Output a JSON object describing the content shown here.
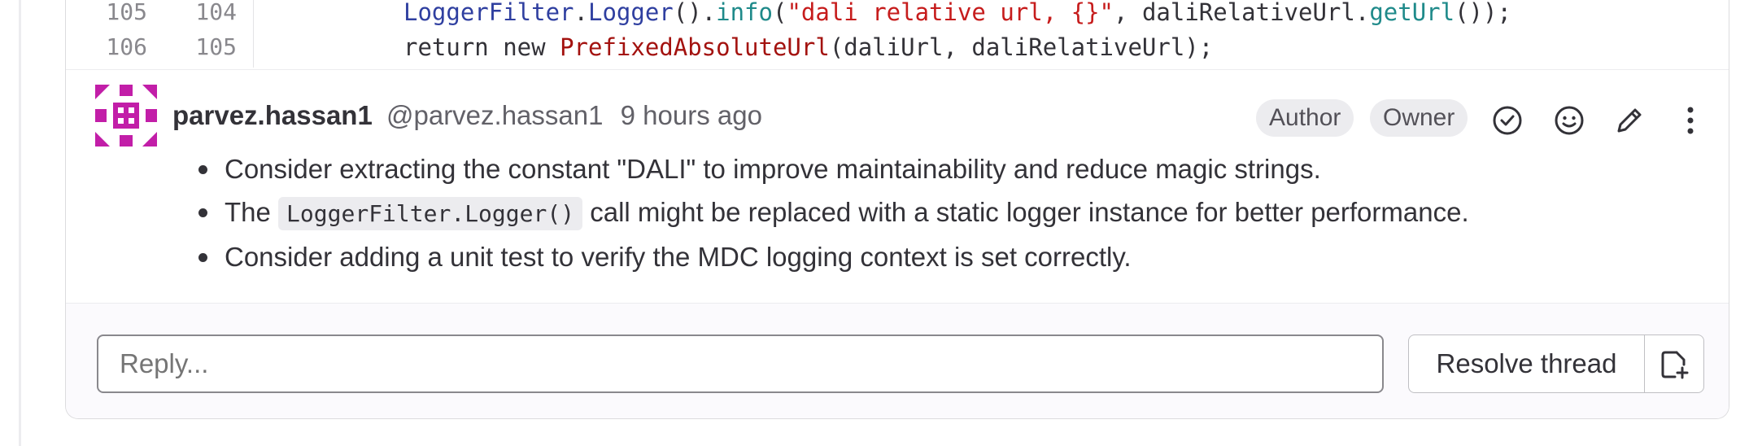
{
  "diff": {
    "lines": [
      {
        "old": "105",
        "new": "104",
        "tokens": [
          {
            "t": "LoggerFilter",
            "c": "cls"
          },
          {
            "t": ".",
            "c": "kw"
          },
          {
            "t": "Logger",
            "c": "cls"
          },
          {
            "t": "().",
            "c": "kw"
          },
          {
            "t": "info",
            "c": "fn"
          },
          {
            "t": "(",
            "c": "kw"
          },
          {
            "t": "\"dali relative url, {}\"",
            "c": "str"
          },
          {
            "t": ", daliRelativeUrl.",
            "c": "kw"
          },
          {
            "t": "getUrl",
            "c": "fn"
          },
          {
            "t": "());",
            "c": "kw"
          }
        ]
      },
      {
        "old": "106",
        "new": "105",
        "tokens": [
          {
            "t": "return new ",
            "c": "kw"
          },
          {
            "t": "PrefixedAbsoluteUrl",
            "c": "type"
          },
          {
            "t": "(daliUrl, daliRelativeUrl);",
            "c": "kw"
          }
        ]
      }
    ]
  },
  "note": {
    "author_name": "parvez.hassan1",
    "author_handle": "@parvez.hassan1",
    "time": "9 hours ago",
    "badge_author": "Author",
    "badge_owner": "Owner",
    "bullet_1": "Consider extracting the constant \"DALI\" to improve maintainability and reduce magic strings.",
    "bullet_2_pre": "The",
    "bullet_2_code": "LoggerFilter.Logger()",
    "bullet_2_post": "call might be replaced with a static logger instance for better performance.",
    "bullet_3": "Consider adding a unit test to verify the MDC logging context is set correctly.",
    "icons": [
      "resolve-check-icon",
      "emoji-smile-icon",
      "pencil-edit-icon",
      "more-vertical-icon"
    ]
  },
  "reply": {
    "placeholder": "Reply...",
    "resolve_label": "Resolve thread"
  },
  "colors": {
    "avatar": "#c21ea8",
    "border": "#dcdcde",
    "badge_bg": "#ececef"
  }
}
